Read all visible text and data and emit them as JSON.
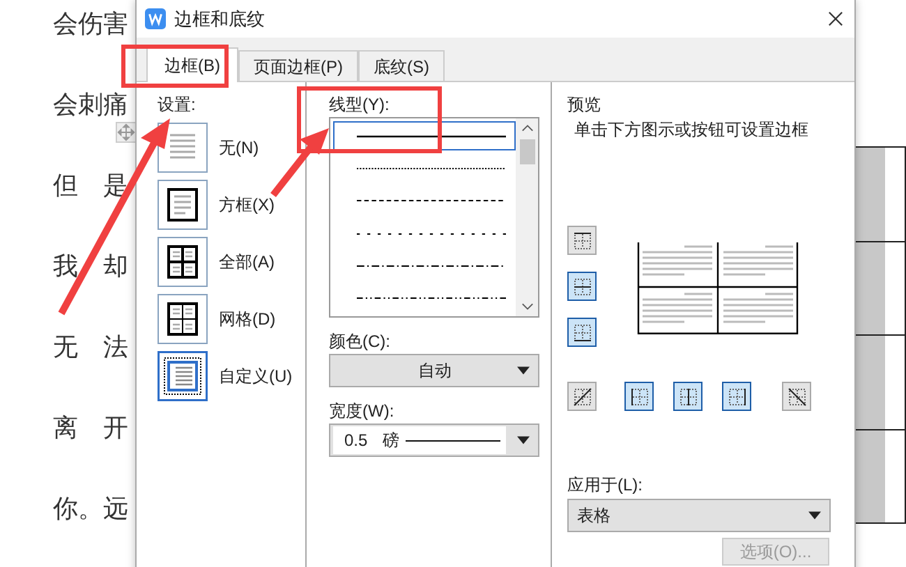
{
  "document": {
    "lines": [
      "会伤害",
      "会刺痛",
      "但　是",
      "我　却",
      "无　法",
      "离　开",
      "你。远"
    ]
  },
  "dialog": {
    "title": "边框和底纹"
  },
  "tabs": [
    {
      "label": "边框(B)",
      "selected": true
    },
    {
      "label": "页面边框(P)",
      "selected": false
    },
    {
      "label": "底纹(S)",
      "selected": false
    }
  ],
  "settings": {
    "label": "设置:",
    "items": [
      {
        "label": "无(N)",
        "kind": "none",
        "selected": false
      },
      {
        "label": "方框(X)",
        "kind": "box",
        "selected": false
      },
      {
        "label": "全部(A)",
        "kind": "all",
        "selected": false
      },
      {
        "label": "网格(D)",
        "kind": "grid",
        "selected": false
      },
      {
        "label": "自定义(U)",
        "kind": "custom",
        "selected": true
      }
    ]
  },
  "line_style": {
    "label": "线型(Y):",
    "styles": [
      {
        "kind": "solid",
        "selected": true
      },
      {
        "kind": "dotted",
        "selected": false
      },
      {
        "kind": "dashed",
        "selected": false
      },
      {
        "kind": "sparse",
        "selected": false
      },
      {
        "kind": "dash-dot",
        "selected": false
      },
      {
        "kind": "dash-dot-dot",
        "selected": false
      }
    ]
  },
  "color": {
    "label": "颜色(C):",
    "value": "自动"
  },
  "width": {
    "label": "宽度(W):",
    "value": "0.5",
    "unit": "磅"
  },
  "preview": {
    "label": "预览",
    "hint": "单击下方图示或按钮可设置边框",
    "side_buttons": [
      {
        "kind": "top",
        "selected": false
      },
      {
        "kind": "middle",
        "selected": true
      },
      {
        "kind": "bottom",
        "selected": true
      }
    ],
    "bottom_buttons": [
      {
        "kind": "diag-up",
        "selected": false
      },
      {
        "kind": "left",
        "selected": true
      },
      {
        "kind": "center",
        "selected": true
      },
      {
        "kind": "right",
        "selected": true
      },
      {
        "kind": "diag-down",
        "selected": false
      }
    ]
  },
  "apply_to": {
    "label": "应用于(L):",
    "value": "表格"
  },
  "options_button": {
    "label": "选项(O)...",
    "disabled": true
  }
}
